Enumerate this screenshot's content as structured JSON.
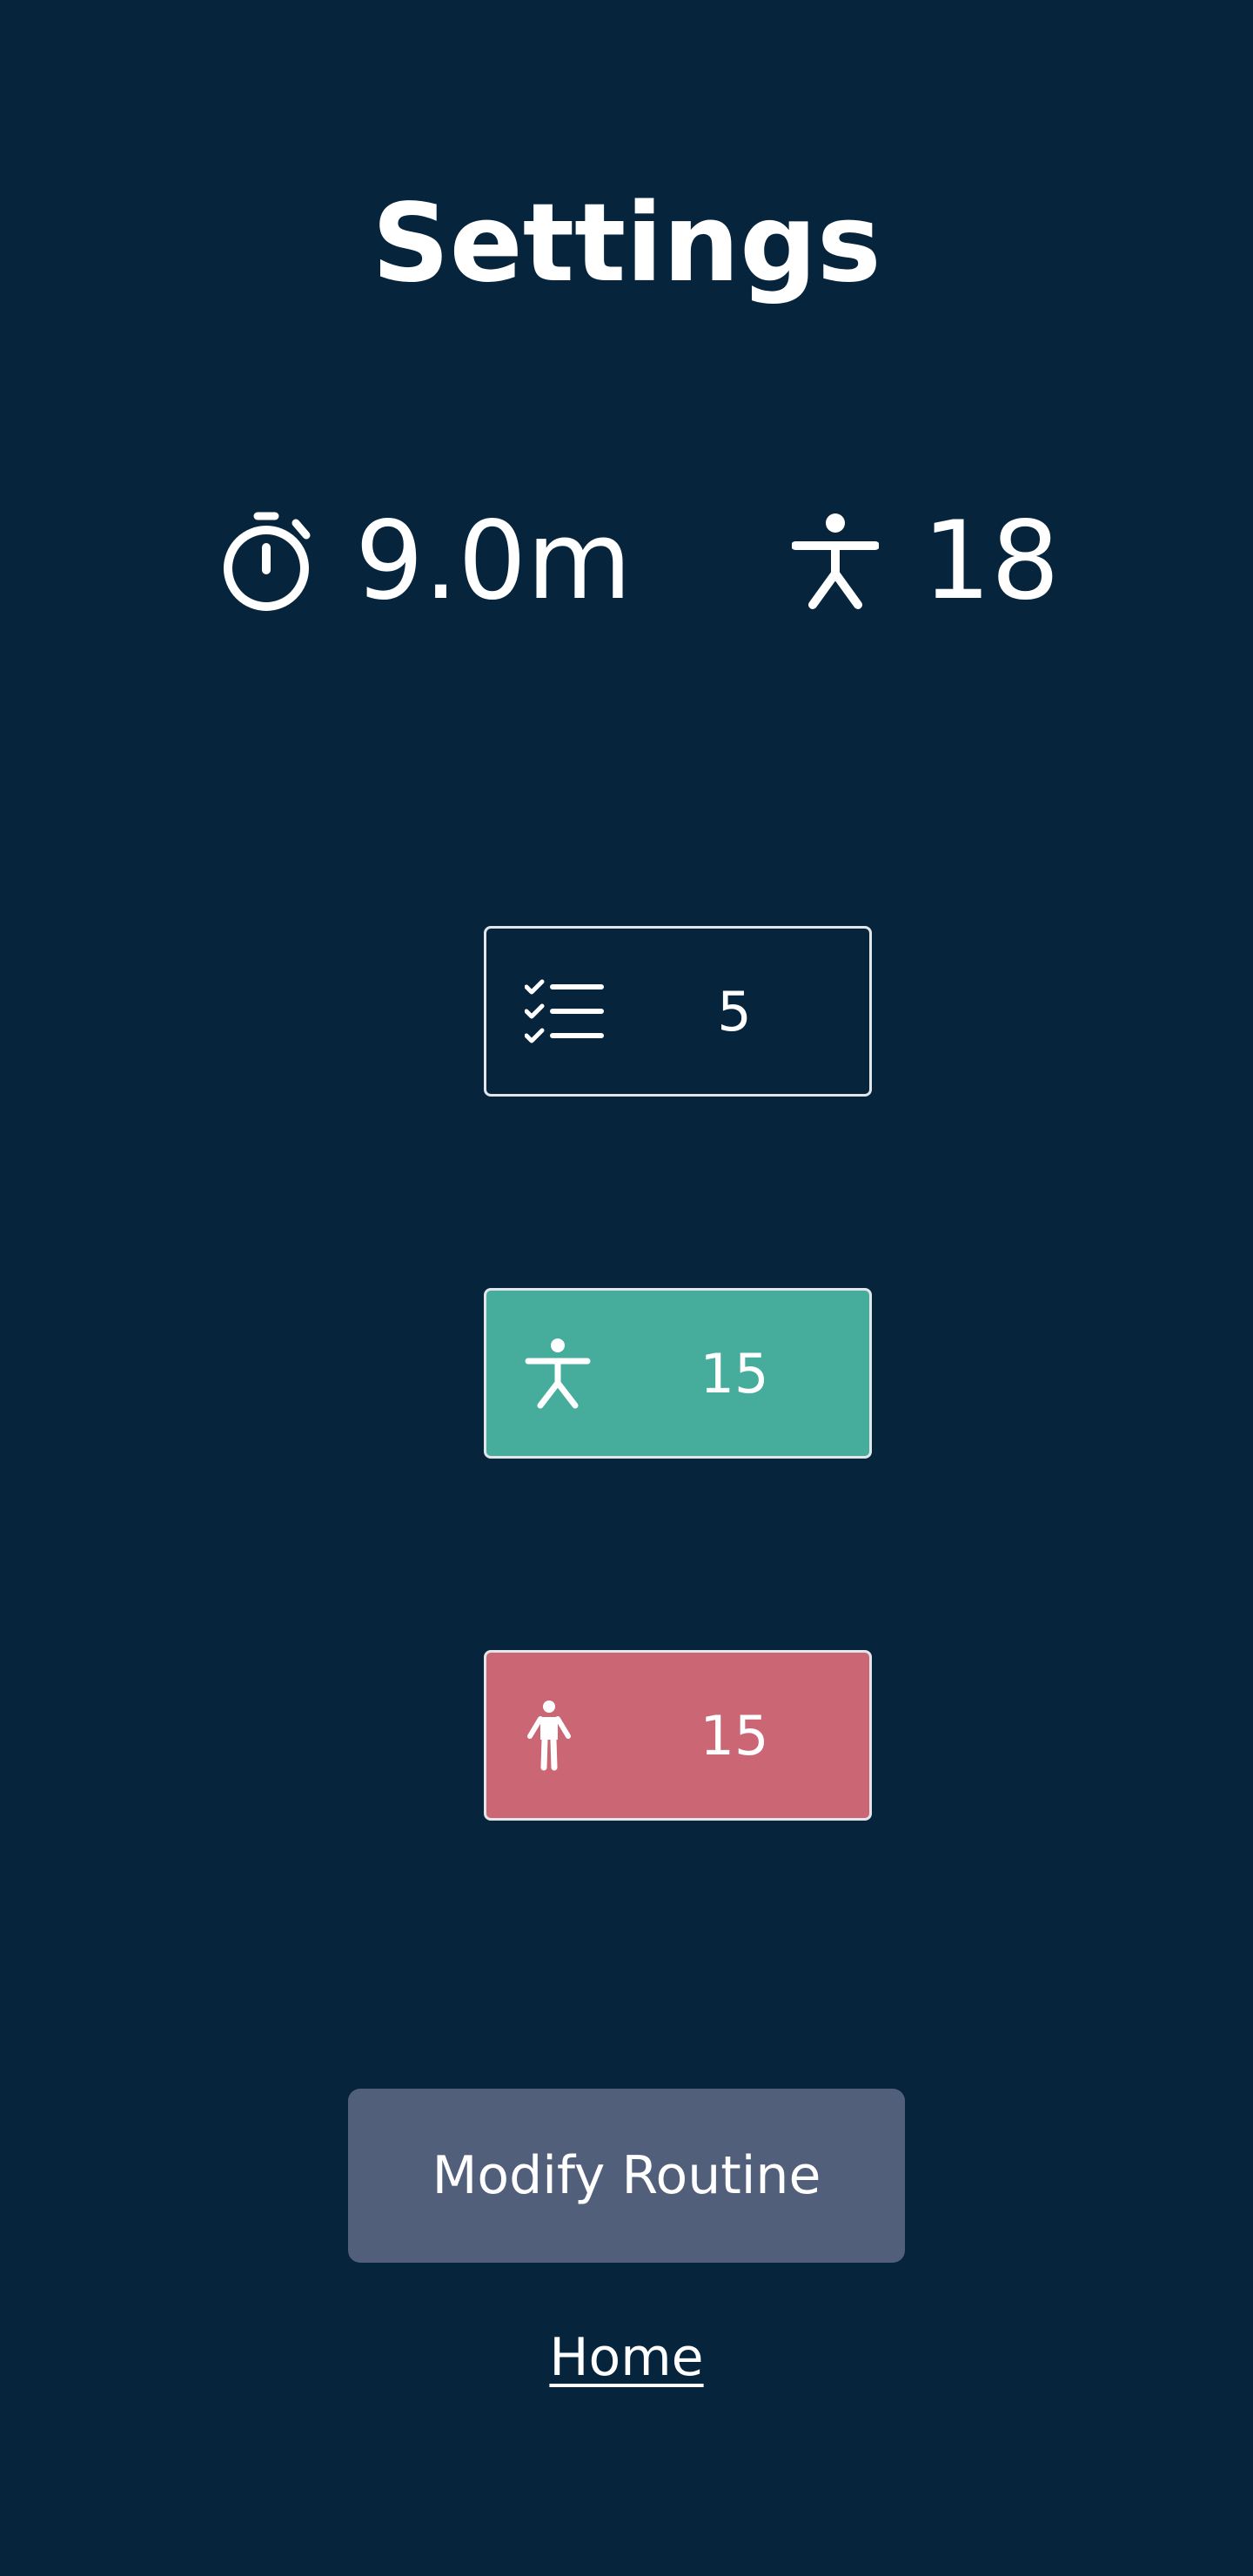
{
  "page": {
    "title": "Settings"
  },
  "stats": {
    "duration": {
      "icon": "stopwatch-icon",
      "value": "9.0m"
    },
    "poses": {
      "icon": "person-pose-icon",
      "value": "18"
    }
  },
  "settings": [
    {
      "id": "sets",
      "icon": "checklist-icon",
      "value": "5",
      "color": "#06253d"
    },
    {
      "id": "pose-count",
      "icon": "person-pose-icon",
      "value": "15",
      "color": "#46ac9b"
    },
    {
      "id": "rest",
      "icon": "person-standing-icon",
      "value": "15",
      "color": "#cb6675"
    }
  ],
  "actions": {
    "modify_label": "Modify Routine",
    "modify_color": "#525f7b",
    "home_label": "Home"
  },
  "colors": {
    "background": "#06253d",
    "text": "#ffffff",
    "border": "#e2e5ea"
  }
}
